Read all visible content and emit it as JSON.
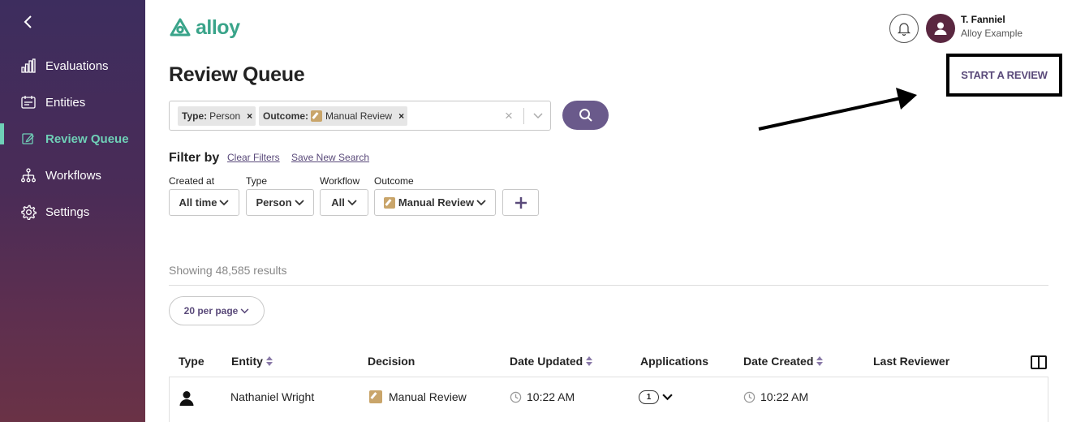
{
  "sidebar": {
    "items": [
      {
        "label": "Evaluations",
        "icon": "bar-chart-icon"
      },
      {
        "label": "Entities",
        "icon": "id-card-icon"
      },
      {
        "label": "Review Queue",
        "icon": "edit-icon",
        "active": true
      },
      {
        "label": "Workflows",
        "icon": "workflow-icon"
      },
      {
        "label": "Settings",
        "icon": "gear-icon"
      }
    ]
  },
  "header": {
    "logo_text": "alloy",
    "user_name": "T. Fanniel",
    "user_org": "Alloy Example"
  },
  "page": {
    "title": "Review Queue",
    "start_review": "START A REVIEW"
  },
  "search": {
    "chips": [
      {
        "key": "Type:",
        "value": "Person"
      },
      {
        "key": "Outcome:",
        "value": "Manual Review"
      }
    ]
  },
  "filters": {
    "heading": "Filter by",
    "clear": "Clear Filters",
    "save": "Save New Search",
    "created_at": {
      "label": "Created at",
      "value": "All time"
    },
    "type": {
      "label": "Type",
      "value": "Person"
    },
    "workflow": {
      "label": "Workflow",
      "value": "All"
    },
    "outcome": {
      "label": "Outcome",
      "value": "Manual Review"
    }
  },
  "results": {
    "text": "Showing 48,585 results",
    "per_page": "20 per page"
  },
  "table": {
    "headers": [
      "Type",
      "Entity",
      "Decision",
      "Date Updated",
      "Applications",
      "Date Created",
      "Last Reviewer"
    ],
    "rows": [
      {
        "entity": "Nathaniel Wright",
        "decision": "Manual Review",
        "date_updated": "10:22 AM",
        "applications": "1",
        "date_created": "10:22 AM",
        "last_reviewer": ""
      }
    ]
  },
  "colors": {
    "accent": "#6fd0b7",
    "brand_purple": "#6a5a8b",
    "logo_green": "#3aa48a"
  }
}
